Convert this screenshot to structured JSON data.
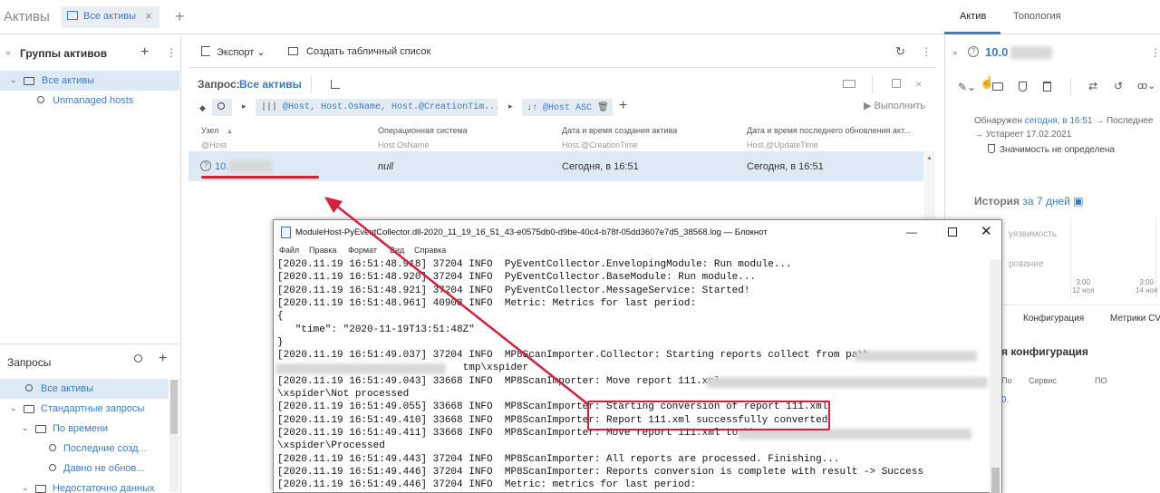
{
  "app": {
    "title": "Активы"
  },
  "tabs": [
    {
      "label": "Все активы",
      "close": "×"
    }
  ],
  "tab_add": "+",
  "right_tabs": [
    {
      "label": "Актив",
      "active": true
    },
    {
      "label": "Топология",
      "active": false
    }
  ],
  "left": {
    "groups_title": "Группы активов",
    "groups": [
      {
        "label": "Все активы",
        "selected": true
      },
      {
        "label": "Unmanaged hosts"
      }
    ],
    "queries_title": "Запросы",
    "queries": [
      {
        "label": "Все активы",
        "selected": true
      },
      {
        "label": "Стандартные запросы"
      },
      {
        "label": "По времени"
      },
      {
        "label": "Последние созд..."
      },
      {
        "label": "Давно не обнов..."
      },
      {
        "label": "Недостаточно данных"
      }
    ]
  },
  "toolbar": {
    "export": "Экспорт",
    "create_table": "Создать табличный список"
  },
  "query": {
    "label": "Запрос:",
    "name": "Все активы",
    "fields": "@Host, Host.OsName, Host.@CreationTim...",
    "sort": "@Host ASC",
    "run": "Выполнить"
  },
  "table": {
    "columns": [
      {
        "title": "Узел",
        "sub": "@Host"
      },
      {
        "title": "Операционная система",
        "sub": "Host.OsName"
      },
      {
        "title": "Дата и время создания актива",
        "sub": "Host.@CreationTime"
      },
      {
        "title": "Дата и время последнего обновления акт...",
        "sub": "Host.@UpdateTime"
      }
    ],
    "rows": [
      {
        "host": "10.",
        "os": "null",
        "created": "Сегодня, в 16:51",
        "updated": "Сегодня, в 16:51"
      }
    ]
  },
  "right": {
    "ip": "10.0",
    "detected_prefix": "Обнаружен",
    "detected_value": "сегодня, в 16:51",
    "latest": "→ Последнее",
    "expires": "→ Устареет 17.02.2021",
    "significance": "Значимость не определена",
    "history_prefix": "История",
    "history_value": "за 7 дней",
    "history_rows": [
      "уязвимость",
      "рование"
    ],
    "chart_ticks": [
      {
        "time": "3:00",
        "date": "12 ноя"
      },
      {
        "time": "3:00",
        "date": "14 ноя"
      }
    ],
    "subtabs": [
      "Конфигурация",
      "Метрики CV"
    ],
    "config_title": "я конфигурация",
    "config_cols": [
      "По",
      "Сервис",
      "ПО"
    ],
    "config_row": "0."
  },
  "notepad": {
    "title": "ModuleHost-PyEventCollector.dll-2020_11_19_16_51_43-e0575db0-d9be-40c4-b78f-05dd3607e7d5_38568.log — Блокнот",
    "menu": [
      "Файл",
      "Правка",
      "Формат",
      "Вид",
      "Справка"
    ],
    "lines": [
      "[2020.11.19 16:51:48.918] 37204 INFO  PyEventCollector.EnvelopingModule: Run module...",
      "[2020.11.19 16:51:48.920] 37204 INFO  PyEventCollector.BaseModule: Run module...",
      "[2020.11.19 16:51:48.921] 37204 INFO  PyEventCollector.MessageService: Started!",
      "[2020.11.19 16:51:48.961] 40908 INFO  Metric: Metrics for last period:",
      "{",
      "   \"time\": \"2020-11-19T13:51:48Z\"",
      "}",
      "[2020.11.19 16:51:49.037] 37204 INFO  MP8ScanImporter.Collector: Starting reports collect from path",
      "                               tmp\\xspider",
      "[2020.11.19 16:51:49.043] 33668 INFO  MP8ScanImporter: Move report 111.xml",
      "\\xspider\\Not processed",
      "[2020.11.19 16:51:49.055] 33668 INFO  MP8ScanImporter: Starting conversion of report 111.xml",
      "[2020.11.19 16:51:49.410] 33668 INFO  MP8ScanImporter: Report 111.xml successfully converted",
      "[2020.11.19 16:51:49.411] 33668 INFO  MP8ScanImporter: Move report 111.xml to \\\\",
      "\\xspider\\Processed",
      "[2020.11.19 16:51:49.443] 37204 INFO  MP8ScanImporter: All reports are processed. Finishing...",
      "[2020.11.19 16:51:49.446] 37204 INFO  MP8ScanImporter: Reports conversion is complete with result -> Success",
      "[2020.11.19 16:51:49.446] 37204 INFO  Metric: metrics for last period:"
    ]
  },
  "colors": {
    "accent": "#3a7bc8",
    "highlight": "#d31f3b",
    "selection": "#ddeaf6"
  }
}
